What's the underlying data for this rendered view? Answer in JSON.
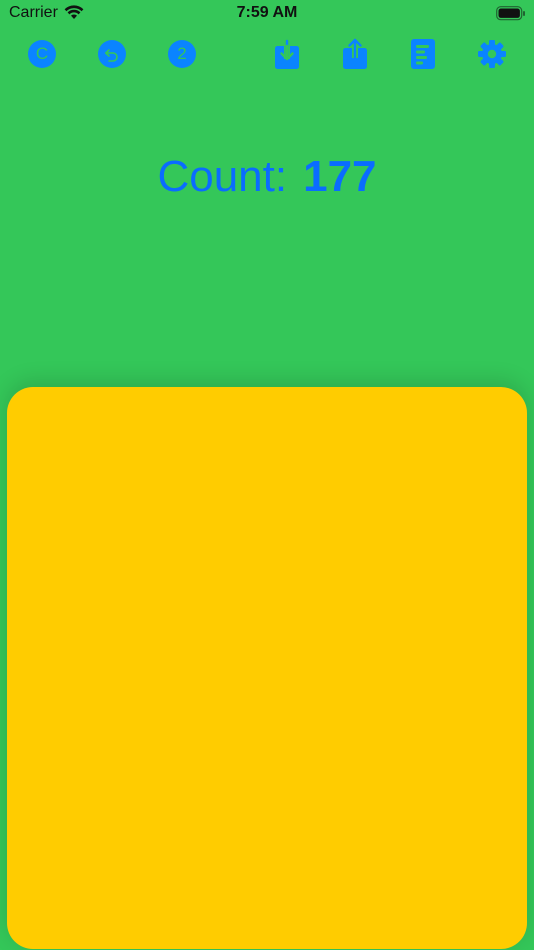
{
  "status_bar": {
    "carrier": "Carrier",
    "time": "7:59 AM"
  },
  "toolbar": {
    "clear_label": "C",
    "decrement_label": "2",
    "icons": [
      "clear-icon",
      "undo-icon",
      "step-icon",
      "import-icon",
      "share-icon",
      "history-icon",
      "gear-icon"
    ]
  },
  "counter": {
    "label": "Count:",
    "value": "177"
  },
  "colors": {
    "background": "#34C759",
    "accent": "#0A84FF",
    "tap_pad": "#FFCC00"
  }
}
